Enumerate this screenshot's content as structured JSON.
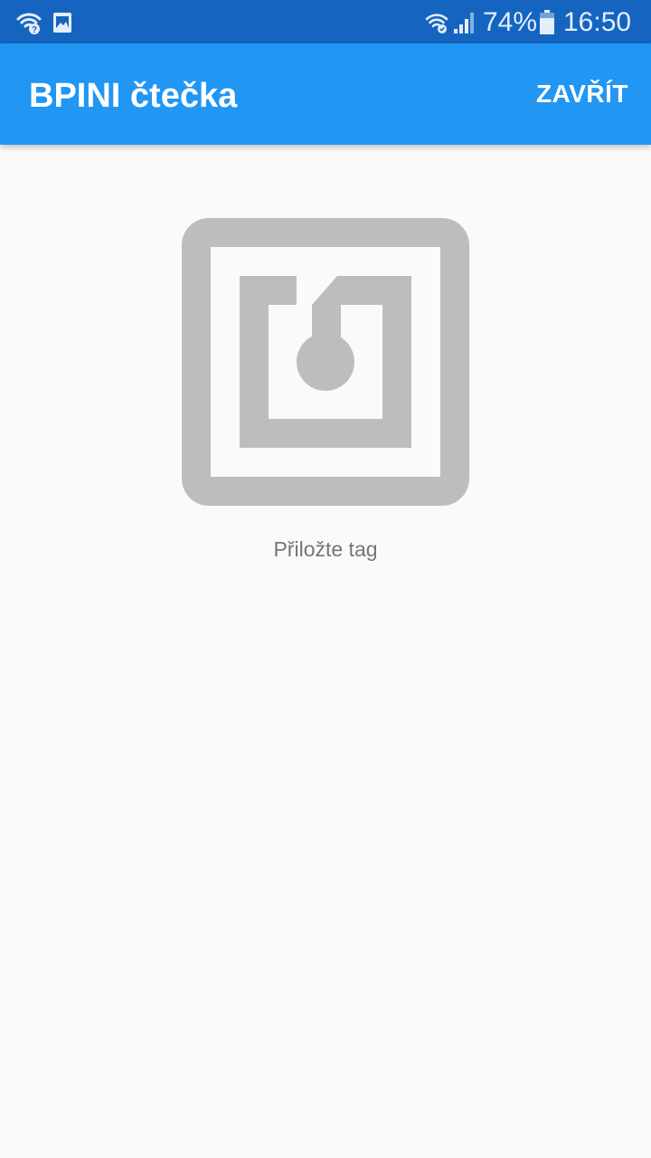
{
  "status_bar": {
    "battery_percent": "74%",
    "time": "16:50",
    "icons": [
      "wifi-question-icon",
      "image-icon",
      "wifi-calling-icon",
      "signal-icon",
      "battery-icon"
    ],
    "battery_level": 0.74
  },
  "app_bar": {
    "title": "BPINI čtečka",
    "close_label": "ZAVŘÍT",
    "color": "#2196f3"
  },
  "main": {
    "icon": "nfc-icon",
    "prompt": "Přiložte tag",
    "icon_color": "#bdbdbd"
  },
  "colors": {
    "status_bar": "#1565c0",
    "background": "#fafafa",
    "prompt_text": "#757575"
  }
}
